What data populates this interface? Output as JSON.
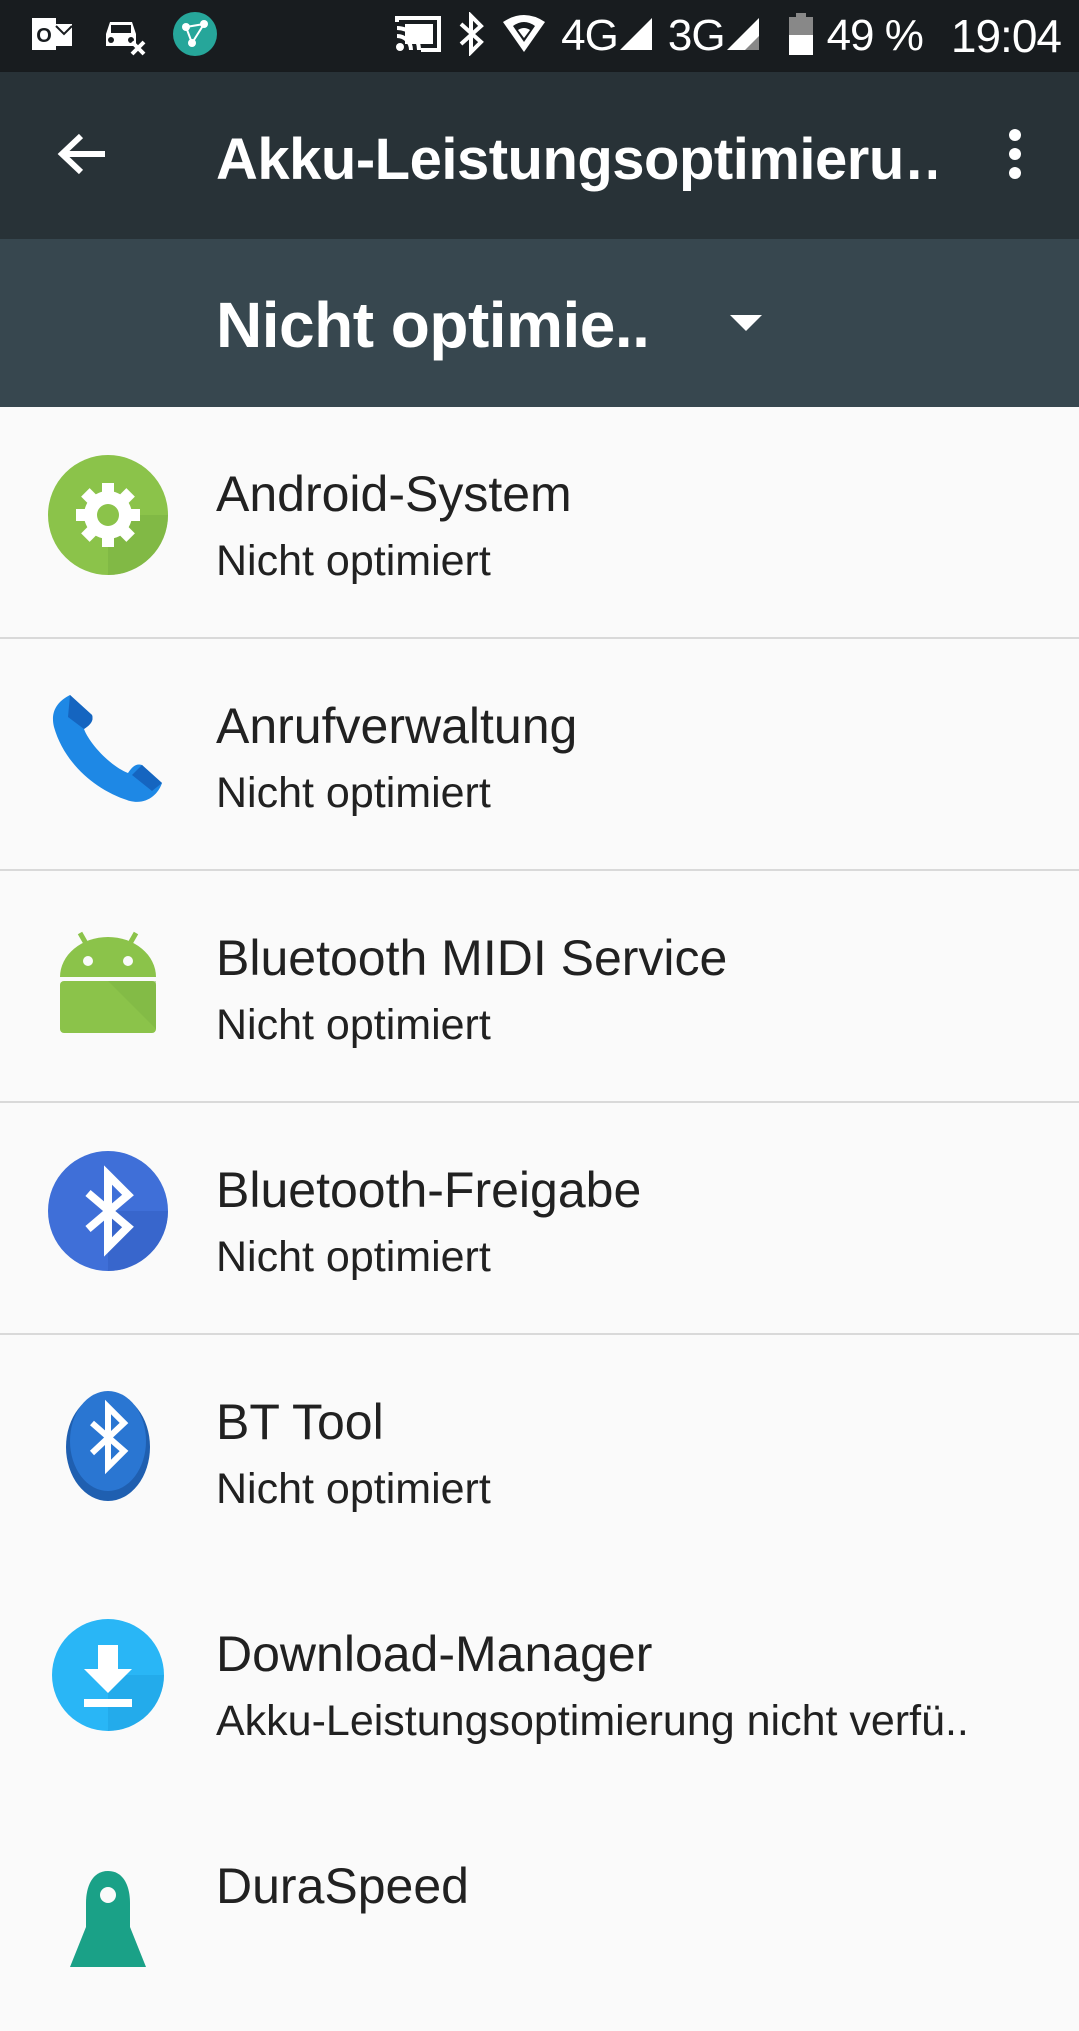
{
  "status_bar": {
    "battery_percent": "49 %",
    "time": "19:04",
    "network_1": "4G",
    "network_2": "3G",
    "icons": [
      "outlook-icon",
      "car-crossed-icon",
      "network-app-icon",
      "cast-icon",
      "bluetooth-icon",
      "wifi-icon",
      "signal-icon",
      "battery-icon"
    ]
  },
  "app_bar": {
    "title": "Akku-Leistungsoptimieru…"
  },
  "filter": {
    "selected": "Nicht optimie.."
  },
  "apps": [
    {
      "name": "Android-System",
      "status": "Nicht optimiert",
      "icon": "gear-icon"
    },
    {
      "name": "Anrufverwaltung",
      "status": "Nicht optimiert",
      "icon": "phone-icon"
    },
    {
      "name": "Bluetooth MIDI Service",
      "status": "Nicht optimiert",
      "icon": "android-icon"
    },
    {
      "name": "Bluetooth-Freigabe",
      "status": "Nicht optimiert",
      "icon": "bluetooth-icon"
    },
    {
      "name": "BT Tool",
      "status": "Nicht optimiert",
      "icon": "bluetooth-badge-icon"
    },
    {
      "name": "Download-Manager",
      "status": "Akku-Leistungsoptimierung nicht verfü..",
      "icon": "download-icon"
    },
    {
      "name": "DuraSpeed",
      "status": "",
      "icon": "rocket-icon"
    }
  ],
  "colors": {
    "status_bar": "#181c1f",
    "app_bar": "#283237",
    "filter_bar": "#37474f",
    "list_bg": "#fafafa",
    "divider": "#d9d9d9"
  }
}
